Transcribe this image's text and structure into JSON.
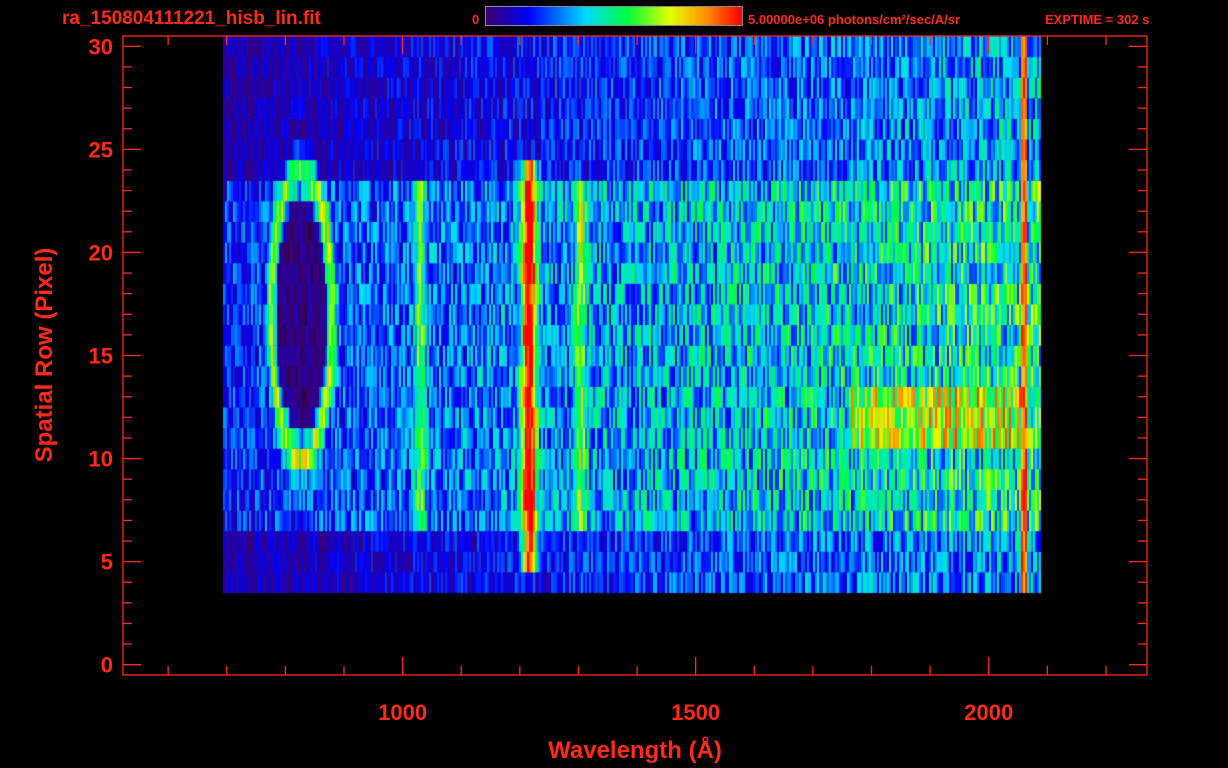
{
  "header": {
    "filename": "ra_150804111221_hisb_lin.fit",
    "colorbar_min": "0",
    "colorbar_max": "5.00000e+06 photons/cm²/sec/A/sr",
    "exptime": "EXPTIME = 302 s"
  },
  "colors": {
    "text": "#ff2a1a",
    "axes": "#ff2a1a",
    "background": "#000000"
  },
  "chart_data": {
    "type": "heatmap",
    "colormap": "rainbow (black-purple-blue-cyan-green-yellow-red)",
    "xlabel": "Wavelength (Å)",
    "ylabel": "Spatial Row (Pixel)",
    "xlim": [
      523,
      2270
    ],
    "ylim": [
      -0.5,
      30.5
    ],
    "x_ticks": [
      1000,
      1500,
      2000
    ],
    "y_ticks": [
      0,
      5,
      10,
      15,
      20,
      25,
      30
    ],
    "signal_x_range": [
      693,
      2090
    ],
    "signal_row_range": [
      4,
      30
    ],
    "features": [
      {
        "feature": "ring",
        "x_range": [
          775,
          880
        ],
        "row_range": [
          10,
          24
        ]
      },
      {
        "feature": "emission line",
        "x": 1216,
        "row_range": [
          5,
          24
        ]
      },
      {
        "feature": "emission line",
        "x": 1030,
        "row_range": [
          7,
          23
        ]
      },
      {
        "feature": "emission line",
        "x": 1304,
        "row_range": [
          7,
          23
        ]
      },
      {
        "feature": "bright band",
        "x_range": [
          1760,
          2070
        ],
        "row_range": [
          11,
          13
        ]
      },
      {
        "feature": "edge",
        "x": 2060,
        "row_range": [
          3,
          30
        ]
      }
    ]
  }
}
